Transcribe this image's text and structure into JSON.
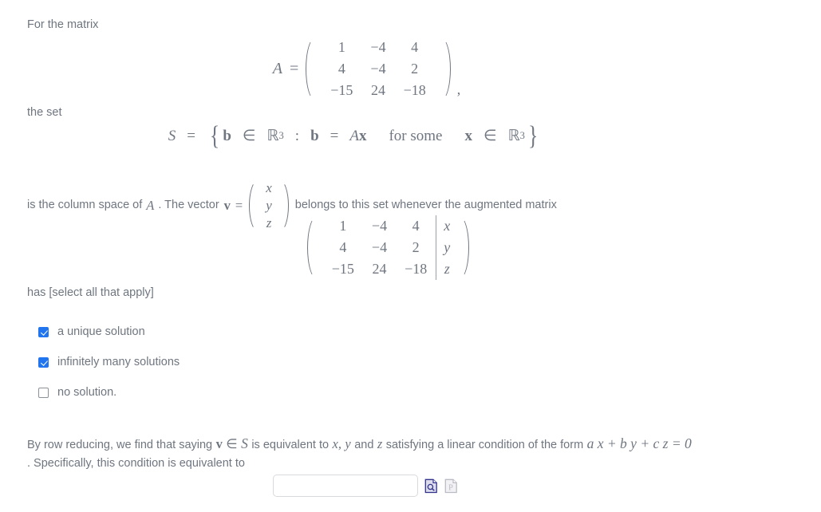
{
  "problem": {
    "intro_line": "For the matrix",
    "the_set_line": "the set",
    "matrix_a": {
      "label": "A",
      "equals": "=",
      "rows": [
        [
          "1",
          "−4",
          "4"
        ],
        [
          "4",
          "−4",
          "2"
        ],
        [
          "−15",
          "24",
          "−18"
        ]
      ],
      "trailing_punctuation": ","
    },
    "set_definition": {
      "name": "S",
      "equals": "=",
      "open_brace": "{",
      "close_brace": "}",
      "element": "b",
      "member_symbol": "∈",
      "space": "ℝ",
      "dimension": "3",
      "colon": ":",
      "condition_lhs": "b",
      "condition_equals": "=",
      "condition_rhs_matrix": "A",
      "condition_rhs_vector": "x",
      "quantifier": "for some",
      "quantifier_var": "x",
      "quantifier_member": "∈",
      "quantifier_space": "ℝ",
      "quantifier_dimension": "3"
    },
    "vector_line": {
      "text_before": "is the column space of",
      "matrix_name": "A",
      "text_middle": ". The vector",
      "vector_name": "v",
      "equals": "=",
      "components": [
        "x",
        "y",
        "z"
      ],
      "text_after": "belongs to this set whenever the augmented matrix"
    },
    "augmented_matrix": {
      "rows": [
        [
          "1",
          "−4",
          "4"
        ],
        [
          "4",
          "−4",
          "2"
        ],
        [
          "−15",
          "24",
          "−18"
        ]
      ],
      "augment_column": [
        "x",
        "y",
        "z"
      ]
    },
    "has_select_line": "has [select all that apply]",
    "options": [
      {
        "label": "a unique solution",
        "checked": true
      },
      {
        "label": "infinitely many solutions",
        "checked": true
      },
      {
        "label": "no solution.",
        "checked": false
      }
    ],
    "closing": {
      "part1": "By row reducing, we find that saying",
      "v_symbol": "v",
      "member_symbol": "∈",
      "set_symbol": "S",
      "part2": "is equivalent to",
      "var_x": "x,",
      "var_y": "y",
      "part3": "and",
      "var_z": "z",
      "part4": "satisfying a linear condition of the form",
      "equation": "a x + b y + c z = 0",
      "part5": ". Specifically, this condition is equivalent to"
    },
    "answer": {
      "value": "",
      "placeholder": ""
    },
    "icons": [
      {
        "name": "preview-page-icon",
        "enabled": true
      },
      {
        "name": "format-page-icon",
        "enabled": false
      }
    ]
  },
  "colors": {
    "text": "#6f7680",
    "checkbox_accent": "#2176f0",
    "input_border": "#d9dadd",
    "icon_fill": "#dcdcec",
    "icon_stroke": "#33338c",
    "icon_disabled": "#b8b8c4"
  }
}
